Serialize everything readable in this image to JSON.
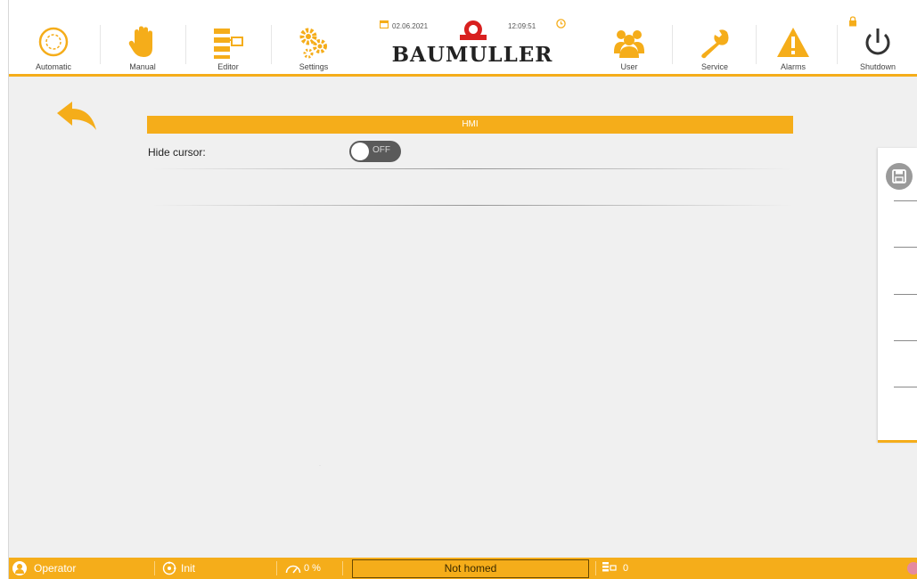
{
  "header": {
    "nav_left": [
      {
        "label": "Automatic",
        "icon": "automatic-icon"
      },
      {
        "label": "Manual",
        "icon": "hand-icon"
      },
      {
        "label": "Editor",
        "icon": "editor-icon"
      },
      {
        "label": "Settings",
        "icon": "gears-icon"
      }
    ],
    "nav_right": [
      {
        "label": "User",
        "icon": "users-icon"
      },
      {
        "label": "Service",
        "icon": "wrench-icon"
      },
      {
        "label": "Alarms",
        "icon": "warning-icon"
      },
      {
        "label": "Shutdown",
        "icon": "power-icon"
      }
    ],
    "date": "02.06.2021",
    "time": "12:09:51",
    "brand": "BAUMULLER"
  },
  "main": {
    "section_title": "HMI",
    "hide_cursor_label": "Hide cursor:",
    "hide_cursor_state": "OFF"
  },
  "footer": {
    "user": "Operator",
    "mode": "Init",
    "override": "0 %",
    "homing_status": "Not homed",
    "program_count": "0"
  },
  "colors": {
    "accent": "#f5ad1a",
    "toggle_off": "#5a5a5a",
    "status_dot": "#e58aa0"
  }
}
